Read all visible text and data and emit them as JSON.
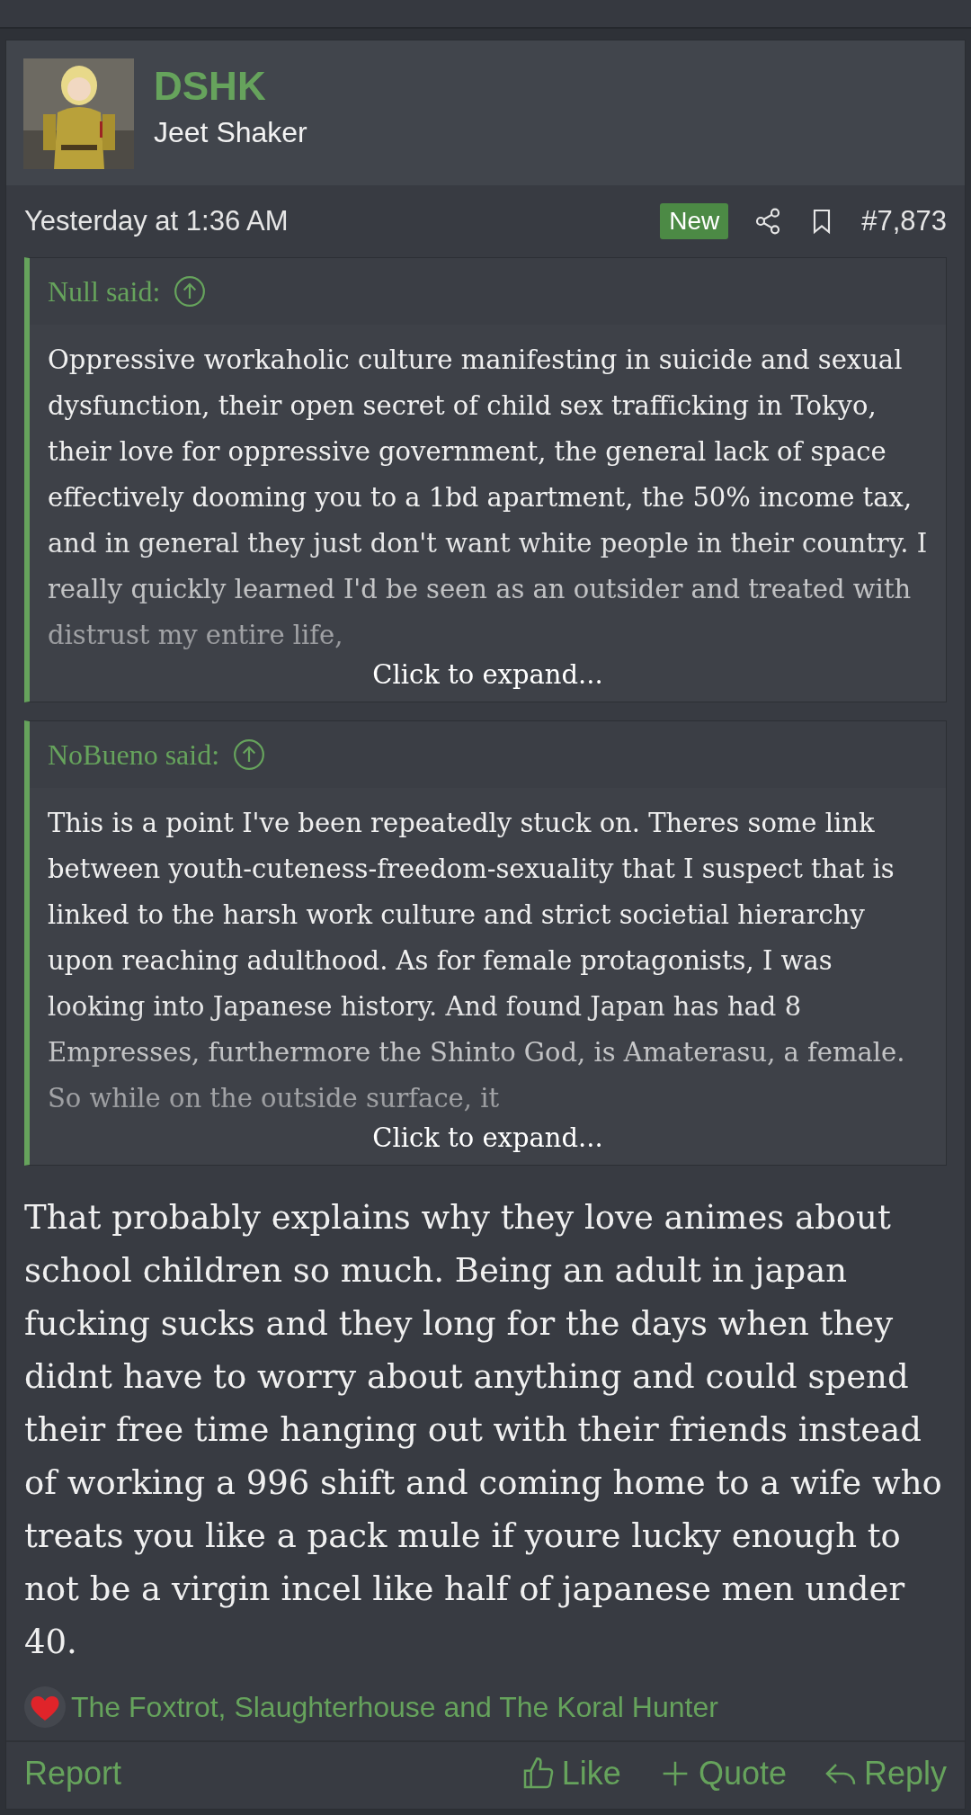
{
  "post": {
    "author": {
      "name": "DSHK",
      "title": "Jeet Shaker"
    },
    "date": "Yesterday at 1:36 AM",
    "badge": "New",
    "number": "#7,873",
    "quotes": [
      {
        "attribution": "Null said:",
        "text": "Oppressive workaholic culture manifesting in suicide and sexual dysfunction, their open secret of child sex trafficking in Tokyo, their love for oppressive government, the general lack of space effectively dooming you to a 1bd apartment, the 50% income tax, and in general they just don't want white people in their country. I really quickly learned I'd be seen as an outsider and treated with distrust my entire life,",
        "expand": "Click to expand..."
      },
      {
        "attribution": "NoBueno said:",
        "text": "This is a point I've been repeatedly stuck on. Theres some link between youth-cuteness-freedom-sexuality that I suspect that is linked to the harsh work culture and strict societial hierarchy upon reaching adulthood. As for female protagonists, I was looking into Japanese history. And found Japan has had 8 Empresses, furthermore the Shinto God, is Amaterasu, a female. So while on the outside surface, it",
        "expand": "Click to expand..."
      }
    ],
    "body": "That probably explains why they love animes about school children so much. Being an adult in japan fucking sucks and they long for the days when they didnt have to worry about anything and could spend their free time hanging out with their friends instead of working a 996 shift and coming home to a wife who treats you like a pack mule if youre lucky enough to not be a virgin incel like half of japanese men under 40.",
    "reactions": "The Foxtrot, Slaughterhouse and The Koral Hunter",
    "actions": {
      "left": [
        "Report"
      ],
      "right": [
        {
          "kind": "like",
          "label": "Like"
        },
        {
          "kind": "quote",
          "label": "Quote"
        },
        {
          "kind": "reply",
          "label": "Reply"
        }
      ]
    }
  }
}
